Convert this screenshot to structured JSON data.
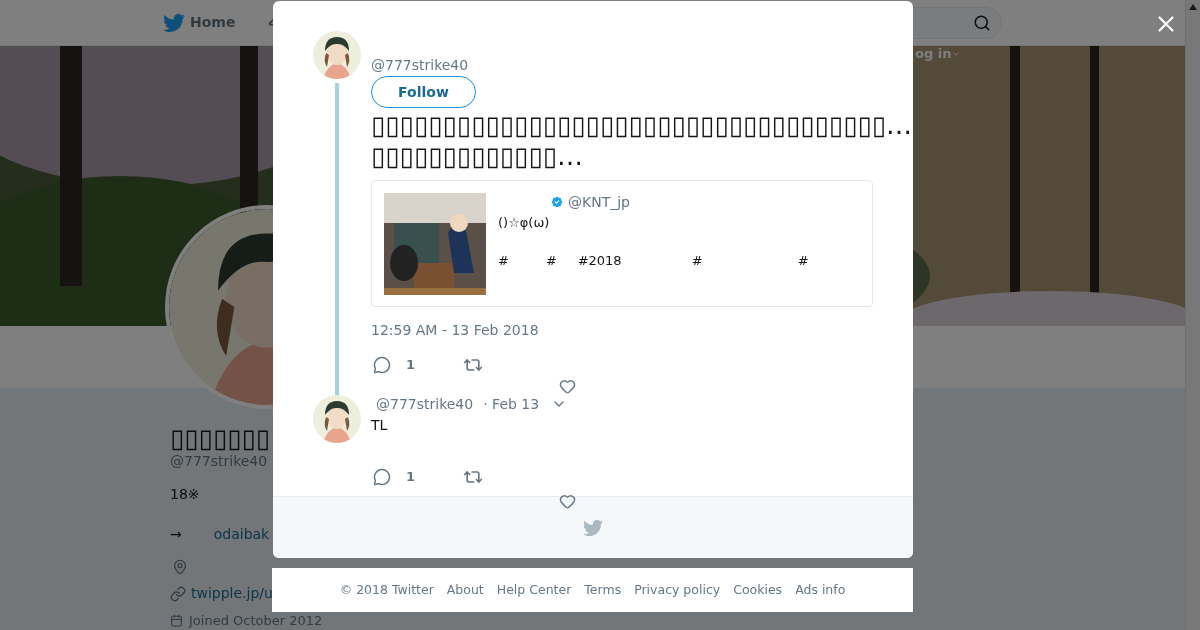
{
  "nav": {
    "home": "Home",
    "login": "og in"
  },
  "profile": {
    "name": "▯▯▯▯▯▯▯",
    "handle": "@777strike40",
    "bio": "18※",
    "arrow": "→",
    "link": "odaibak",
    "url": "twipple.jp/u",
    "joined": "Joined October 2012"
  },
  "main_tweet": {
    "handle": "@777strike40",
    "follow": "Follow",
    "text_lines": [
      "▯▯▯▯▯▯▯▯▯▯▯▯▯▯▯▯▯▯▯▯▯▯▯▯▯▯▯▯▯▯▯▯▯▯▯▯…",
      "▯▯▯▯▯▯▯▯▯▯▯▯▯…"
    ],
    "quote": {
      "handle": "@KNT_jp",
      "verified": true,
      "lines": [
        "()☆φ(ω)",
        "#         #     #2018                 #                       #"
      ]
    },
    "timestamp": "12:59 AM - 13 Feb 2018",
    "replies": "1"
  },
  "reply": {
    "handle": "@777strike40",
    "date": "· Feb 13",
    "text": "TL",
    "replies": "1"
  },
  "footer": [
    "© 2018 Twitter",
    "About",
    "Help Center",
    "Terms",
    "Privacy policy",
    "Cookies",
    "Ads info"
  ]
}
